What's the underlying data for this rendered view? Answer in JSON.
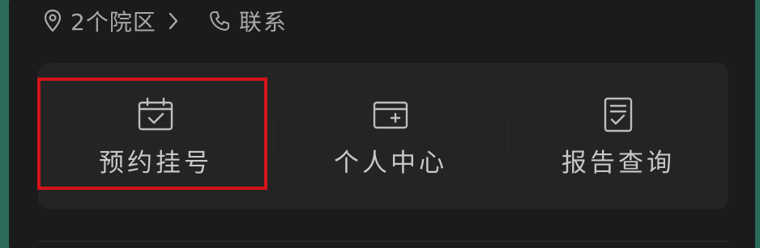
{
  "info": {
    "campus_label": "2个院区",
    "contact_label": "联系",
    "icons": {
      "location": "location-pin-icon",
      "chevron": "chevron-right-icon",
      "phone": "phone-icon"
    }
  },
  "actions": [
    {
      "label": "预约挂号",
      "icon": "calendar-check-icon",
      "highlighted": true
    },
    {
      "label": "个人中心",
      "icon": "card-plus-icon",
      "highlighted": false
    },
    {
      "label": "报告查询",
      "icon": "report-document-icon",
      "highlighted": false
    }
  ],
  "colors": {
    "background": "#1b1b1b",
    "card": "#242424",
    "text": "#c8c8c8",
    "highlight_border": "#d5131b",
    "outer_edge": "#2b6a58"
  }
}
